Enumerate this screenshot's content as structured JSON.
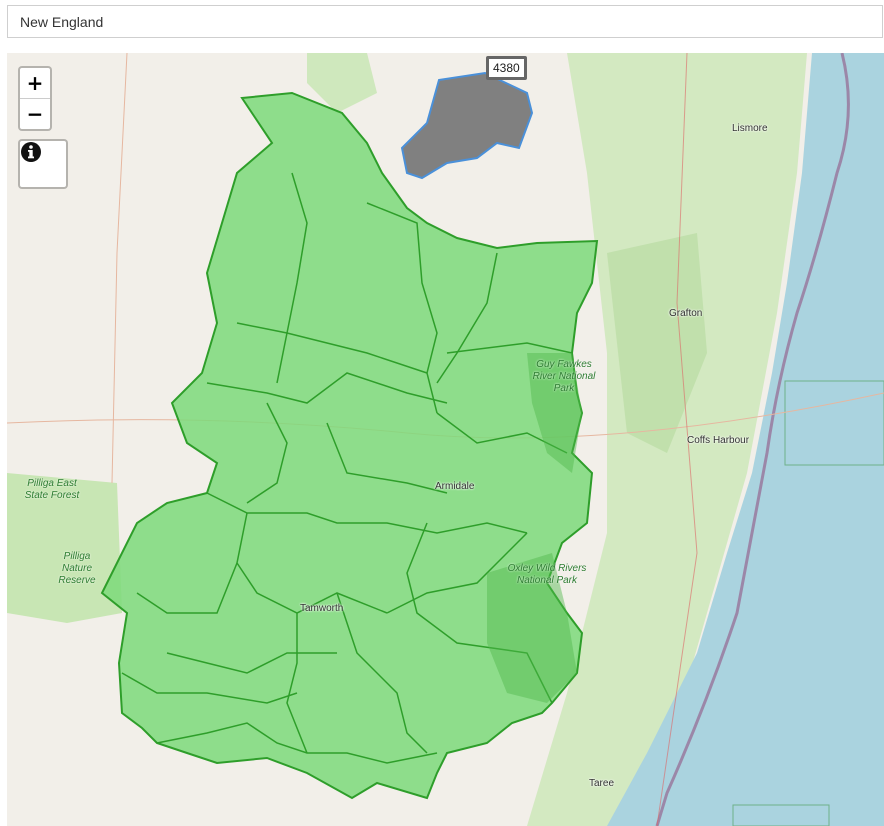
{
  "search": {
    "value": "New England"
  },
  "zoom": {
    "in_label": "+",
    "out_label": "−"
  },
  "info_icon": "info-circle-icon",
  "region_label": "4380",
  "places": {
    "lismore": "Lismore",
    "grafton": "Grafton",
    "coffs_harbour": "Coffs Harbour",
    "armidale": "Armidale",
    "tamworth": "Tamworth",
    "taree": "Taree"
  },
  "parks": {
    "pilliga_east": "Pilliga East State Forest",
    "pilliga_nature": "Pilliga Nature Reserve",
    "guy_fawkes": "Guy Fawkes River National Park",
    "oxley_wild": "Oxley Wild Rivers National Park"
  },
  "colors": {
    "electorate_fill": "#7dd97a",
    "electorate_stroke": "#2e9e2a",
    "neighbour_fill": "#808080",
    "neighbour_stroke": "#4a90d9",
    "ocean": "#aad3df",
    "land": "#f2efe9",
    "forest": "#c8e6b4"
  }
}
